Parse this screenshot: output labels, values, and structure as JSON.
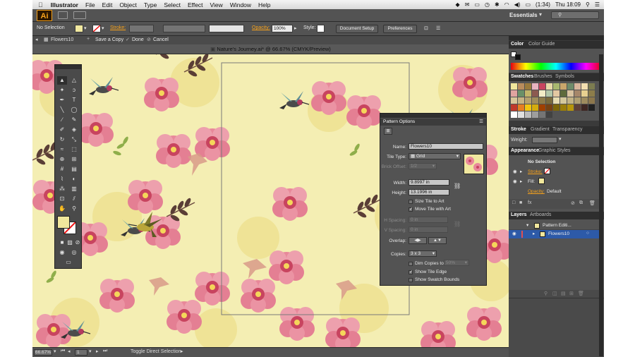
{
  "menubar": {
    "apple": "",
    "app": "Illustrator",
    "items": [
      "File",
      "Edit",
      "Object",
      "Type",
      "Select",
      "Effect",
      "View",
      "Window",
      "Help"
    ],
    "battery": "(1:34)",
    "clock": "Thu 18:09"
  },
  "appbar": {
    "logo": "Ai",
    "workspace": "Essentials",
    "search_placeholder": "▾"
  },
  "control": {
    "selection": "No Selection",
    "stroke_label": "Stroke:",
    "opacity_label": "Opacity:",
    "opacity_value": "100%",
    "style_label": "Style:",
    "document_setup": "Document Setup",
    "preferences": "Preferences"
  },
  "isolation": {
    "pattern_name": "Flowers10",
    "save_copy": "Save a Copy",
    "done": "Done",
    "cancel": "Cancel"
  },
  "document": {
    "title": "Nature's Journey.ai* @ 66.67% (CMYK/Preview)"
  },
  "status": {
    "zoom": "66.67%",
    "page": "1",
    "message": "Toggle Direct Selection"
  },
  "panels": {
    "color": {
      "tabs": [
        "Color",
        "Color Guide"
      ]
    },
    "swatches": {
      "tabs": [
        "Swatches",
        "Brushes",
        "Symbols"
      ]
    },
    "stroke": {
      "tabs": [
        "Stroke",
        "Gradient",
        "Transparency"
      ],
      "weight_label": "Weight:"
    },
    "appearance": {
      "tabs": [
        "Appearance",
        "Graphic Styles"
      ],
      "selection": "No Selection",
      "stroke": "Stroke:",
      "fill": "Fill:",
      "opacity": "Opacity:",
      "opacity_value": "Default"
    },
    "layers": {
      "tabs": [
        "Layers",
        "Artboards"
      ],
      "rows": [
        "Pattern Editi...",
        "Flowers10"
      ]
    }
  },
  "pattern_options": {
    "title": "Pattern Options",
    "name_label": "Name:",
    "name_value": "Flowers10",
    "tile_type_label": "Tile Type:",
    "tile_type_value": "Grid",
    "brick_offset_label": "Brick Offset:",
    "brick_offset_value": "1/2",
    "width_label": "Width:",
    "width_value": "9.8997 in",
    "height_label": "Height:",
    "height_value": "13.1996 in",
    "size_tile": "Size Tile to Art",
    "move_tile": "Move Tile with Art",
    "h_spacing_label": "H Spacing:",
    "h_spacing_value": "0 in",
    "v_spacing_label": "V Spacing:",
    "v_spacing_value": "0 in",
    "overlap_label": "Overlap:",
    "copies_label": "Copies:",
    "copies_value": "3 x 3",
    "dim_copies": "Dim Copies to:",
    "dim_copies_value": "50%",
    "show_tile_edge": "Show Tile Edge",
    "show_swatch_bounds": "Show Swatch Bounds"
  },
  "colors": {
    "accent": "#f7a21b",
    "canvas": "#f4eeb3",
    "flower": "#e8889a",
    "flower_center": "#c8445f"
  }
}
